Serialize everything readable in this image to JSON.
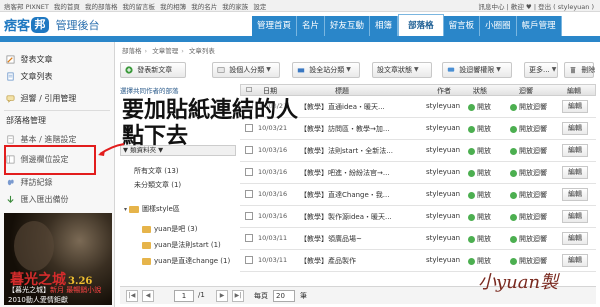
{
  "topbar": {
    "links": [
      "痞客邦 PIXNET",
      "我的首頁",
      "我的部落格",
      "我的留言板",
      "我的相簿",
      "我的名片",
      "我的家族",
      "設定"
    ],
    "right": "訊息中心 | 歡迎 ♥ | 登出 ( styleyuan )"
  },
  "header": {
    "brand": "痞客",
    "badge": "邦",
    "admin_label": "管理後台",
    "tabs": [
      "管理首頁",
      "名片",
      "好友互動",
      "相簿",
      "部落格",
      "留言板",
      "小圈圈",
      "帳戶管理"
    ],
    "active_tab": "部落格"
  },
  "sidebar": {
    "group1": [
      "發表文章",
      "文章列表",
      "迴響 / 引用管理"
    ],
    "group2_title": "部落格管理",
    "group2": [
      "基本 / 進階設定",
      "側邊欄位設定",
      "拜訪紀錄",
      "匯入匯出備份"
    ],
    "ad": {
      "title": "暮光之城",
      "date": "3.26",
      "line1": "【暮光之城】",
      "line1_red": "新月 最暢銷小說",
      "line2": "2010動人愛情鉅獻"
    }
  },
  "breadcrumb": [
    "部落格",
    "文章管理",
    "文章列表"
  ],
  "toolbar": {
    "new_post": "發表新文章",
    "category": "設個人分類",
    "site_category": "設全站分類",
    "status": "設文章狀態",
    "comment_perm": "設迴響權限",
    "more": "更多...",
    "delete": "刪除"
  },
  "folders": {
    "hint": "選擇共同作者的部落",
    "control": "▼ 類資料夾 ▼",
    "items": [
      {
        "label": "所有文章 (13)"
      },
      {
        "label": "未分類文章 (1)"
      }
    ],
    "folder_name": "圖樣style區",
    "subfolders": [
      "yuan是吧 (3)",
      "yuan是法則start (1)",
      "yuan是直達change (1)"
    ]
  },
  "table": {
    "headers": {
      "date": "日期",
      "title": "標題",
      "author": "作者",
      "status": "狀態",
      "comment": "迴響",
      "edit": "編輯"
    },
    "rows": [
      {
        "date": "10/03/21",
        "title": "【教學】直通idea・暖天...",
        "author": "styleyuan",
        "status": "開放",
        "comment": "開放迴響",
        "edit": "編輯"
      },
      {
        "date": "10/03/21",
        "title": "【教學】訪問區・教學→加...",
        "author": "styleyuan",
        "status": "開放",
        "comment": "開放迴響",
        "edit": "編輯"
      },
      {
        "date": "10/03/16",
        "title": "【教學】法則start・全新法...",
        "author": "styleyuan",
        "status": "開放",
        "comment": "開放迴響",
        "edit": "編輯"
      },
      {
        "date": "10/03/16",
        "title": "【教學】吧進・紛紛法官→...",
        "author": "styleyuan",
        "status": "開放",
        "comment": "開放迴響",
        "edit": "編輯"
      },
      {
        "date": "10/03/16",
        "title": "【教學】直達Change・我...",
        "author": "styleyuan",
        "status": "開放",
        "comment": "開放迴響",
        "edit": "編輯"
      },
      {
        "date": "10/03/16",
        "title": "【教學】製作源idea・暖天...",
        "author": "styleyuan",
        "status": "開放",
        "comment": "開放迴響",
        "edit": "編輯"
      },
      {
        "date": "10/03/11",
        "title": "【教學】領廣品場~",
        "author": "styleyuan",
        "status": "開放",
        "comment": "開放迴響",
        "edit": "編輯"
      },
      {
        "date": "10/03/11",
        "title": "【教學】產品製作",
        "author": "styleyuan",
        "status": "開放",
        "comment": "開放迴響",
        "edit": "編輯"
      }
    ]
  },
  "pager": {
    "page_input": "1",
    "page_total": "/1",
    "per_page_label": "每頁",
    "per_page_value": "20",
    "unit": "筆"
  },
  "annotations": {
    "line1": "要加貼紙連結的人",
    "line2": "點下去",
    "signature": "小yuan製"
  }
}
